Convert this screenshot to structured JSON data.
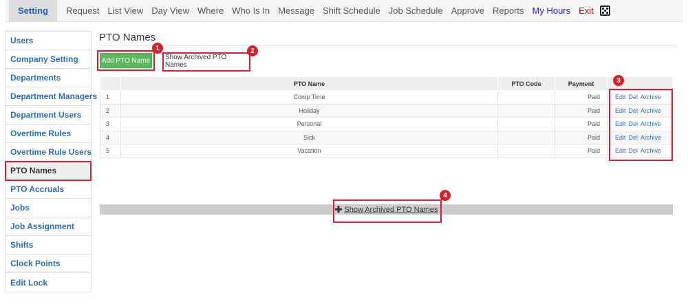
{
  "nav": {
    "active": "Setting",
    "items": [
      "Request",
      "List View",
      "Day View",
      "Where",
      "Who Is In",
      "Message",
      "Shift Schedule",
      "Job Schedule",
      "Approve",
      "Reports"
    ],
    "my_hours": "My Hours",
    "exit": "Exit",
    "icon": "dice-icon"
  },
  "sidebar": {
    "items": [
      "Users",
      "Company Setting",
      "Departments",
      "Department Managers",
      "Department Users",
      "Overtime Rules",
      "Overtime Rule Users",
      "PTO Names",
      "PTO Accruals",
      "Jobs",
      "Job Assignment",
      "Shifts",
      "Clock Points",
      "Edit Lock"
    ],
    "active": "PTO Names"
  },
  "page": {
    "title": "PTO Names",
    "add_button": "Add PTO Name",
    "show_archived_button": "Show Archived PTO Names",
    "toggle_label": "Show Archived PTO Names"
  },
  "table": {
    "headers": [
      "",
      "PTO Name",
      "PTO Code",
      "Payment",
      ""
    ],
    "rows": [
      {
        "num": "1",
        "name": "Comp Time",
        "code": "",
        "payment": "Paid"
      },
      {
        "num": "2",
        "name": "Holiday",
        "code": "",
        "payment": "Paid"
      },
      {
        "num": "3",
        "name": "Personal",
        "code": "",
        "payment": "Paid"
      },
      {
        "num": "4",
        "name": "Sick",
        "code": "",
        "payment": "Paid"
      },
      {
        "num": "5",
        "name": "Vacation",
        "code": "",
        "payment": "Paid"
      }
    ],
    "actions": {
      "edit": "Edit",
      "del": "Del",
      "archive": "Archive"
    }
  },
  "annotations": {
    "b1": "1",
    "b2": "2",
    "b3": "3",
    "b4": "4"
  },
  "colors": {
    "accent": "#2a6ebb",
    "highlight": "#d9202a",
    "add_button": "#5cb85c"
  }
}
